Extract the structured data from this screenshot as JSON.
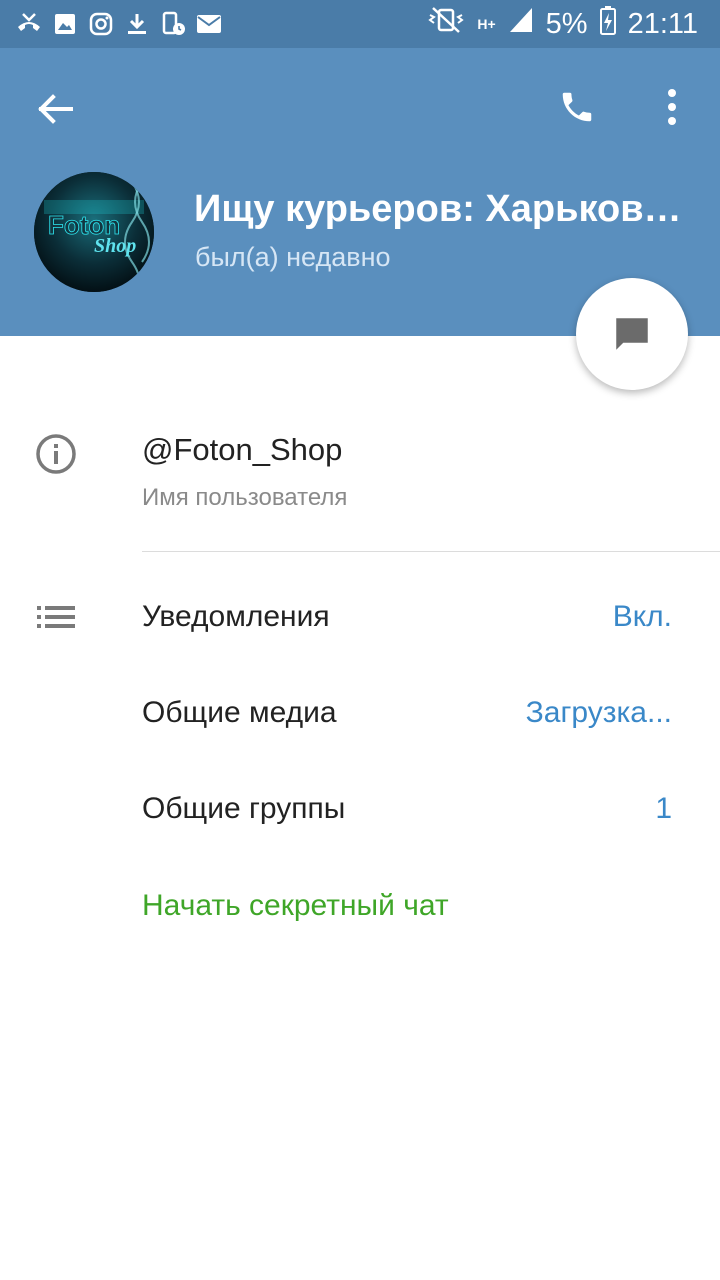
{
  "status_bar": {
    "battery": "5%",
    "time": "21:11",
    "network_type": "H+",
    "left_icons": [
      "missed-call-icon",
      "gallery-icon",
      "instagram-icon",
      "download-icon",
      "screenshot-icon",
      "mail-icon"
    ]
  },
  "header": {
    "title": "Ищу курьеров: Харьков…",
    "subtitle": "был(а) недавно",
    "avatar_text_1": "Foton",
    "avatar_text_2": "Shop",
    "background_color": "#5a8fbe"
  },
  "info": {
    "username": "@Foton_Shop",
    "username_label": "Имя пользователя"
  },
  "settings": [
    {
      "label": "Уведомления",
      "value": "Вкл."
    },
    {
      "label": "Общие медиа",
      "value": "Загрузка..."
    },
    {
      "label": "Общие группы",
      "value": "1"
    }
  ],
  "secret_chat": {
    "label": "Начать секретный чат",
    "color": "#3fa628"
  },
  "colors": {
    "accent_value": "#3a88c8",
    "status_bar": "#4a7ca8"
  }
}
